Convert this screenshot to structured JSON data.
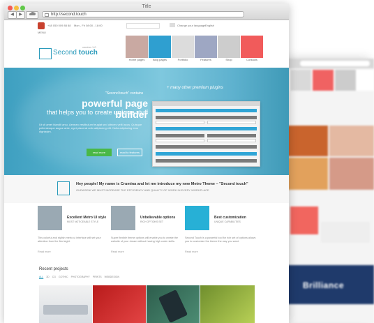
{
  "window": {
    "title": "Title",
    "url": "http://second.touch",
    "back_glyph": "◀",
    "forward_glyph": "▶"
  },
  "top_strip": {
    "contact": "+48 050 009 88 88",
    "hours": "Mon - Fri 08:00 - 18:00",
    "lang_label": "Change your language",
    "lang_value": "English"
  },
  "brand": {
    "name_part1": "Second",
    "name_part2": "touch",
    "version": "version 1.0",
    "menu_label": "MENU"
  },
  "nav_menu": [
    {
      "label": "Home pages",
      "color": "#c9a9a2"
    },
    {
      "label": "Blog pages",
      "color": "#2f9fd0"
    },
    {
      "label": "Portfolio",
      "color": "#dcdcdc"
    },
    {
      "label": "Features",
      "color": "#9ea7c3"
    },
    {
      "label": "Shop",
      "color": "#cdcdcd"
    },
    {
      "label": "Contacts",
      "color": "#f15b5b"
    }
  ],
  "hero": {
    "kicker": "\"Second touch\" contains",
    "script_text": "+ many other premium plugins",
    "title": "powerful page builder",
    "subtitle_pre": "that helps you to create",
    "subtitle_em": "unique",
    "subtitle_post": "stuff",
    "body": "Ut sit amet blandit arcu. Aenean vestibulum feugiat sed ultrices velit lacus. Quisque pellentesque augue ante, eget placerat odio adipiscing elit. Nulla adipiscing eros dignissim.",
    "primary_button": "read more",
    "secondary_button": "read to features"
  },
  "intro": {
    "title": "Hey people! My name is Crumina and let me introduce my new Metro Theme – \"Second touch\"",
    "subtitle": "OURAGENI WE MUST INCREASE THE EFFICIENCY AND QUALITY OF WORK IN EVERY WORKPLACE"
  },
  "features": [
    {
      "title": "Excellent Metro UI style",
      "sub": "MOST NOTICEABLE STYLE",
      "body": "This colorful and stylish metro ui interface will set your attention from the first sight.",
      "more": "Read more",
      "color": "#9aa9b3"
    },
    {
      "title": "Unbelievable options",
      "sub": "RICH OPTIONS SET",
      "body": "Super flexible theme options will enable you to create the website of your dream without having high coder skills.",
      "more": "Read more",
      "color": "#9aa9b3"
    },
    {
      "title": "Best customization",
      "sub": "UNIQUE CAPABILITIES",
      "body": "Second Touch is a powerful tool for rich set of options allows you to customize the theme the way you want.",
      "more": "Read more",
      "color": "#27b0d6"
    }
  ],
  "recent": {
    "title": "Recent projects",
    "filters": [
      "ALL",
      "3D",
      "CG",
      "GOTHIC",
      "PHOTOGRAPHY",
      "PRINTS",
      "WEBDESIGN"
    ]
  },
  "background_window": {
    "promo_text": "Brilliance"
  },
  "colors": {
    "accent": "#2b9bbb",
    "green": "#4ab847",
    "red": "#f15b5b"
  }
}
